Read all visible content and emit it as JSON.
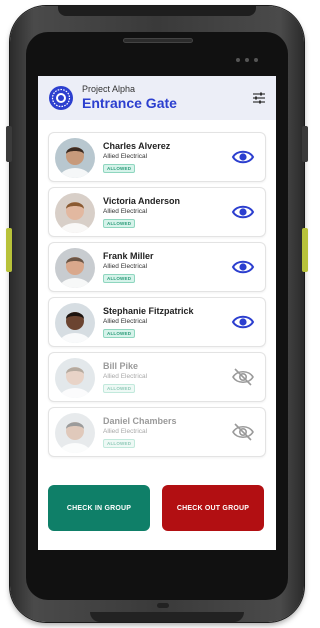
{
  "header": {
    "project": "Project Alpha",
    "gate": "Entrance Gate",
    "filter_icon": "filter-sliders-icon"
  },
  "people": [
    {
      "name": "Charles Alverez",
      "company": "Allied Electrical",
      "status": "ALLOWED",
      "visible": true,
      "skin": "#c79a7b",
      "hair": "#3b2a20",
      "bg": "#b8c7cf"
    },
    {
      "name": "Victoria Anderson",
      "company": "Allied Electrical",
      "status": "ALLOWED",
      "visible": true,
      "skin": "#e2b8a0",
      "hair": "#8a5a32",
      "bg": "#d8cfc8"
    },
    {
      "name": "Frank Miller",
      "company": "Allied Electrical",
      "status": "ALLOWED",
      "visible": true,
      "skin": "#d9a88c",
      "hair": "#6b5545",
      "bg": "#c8ccd0"
    },
    {
      "name": "Stephanie Fitzpatrick",
      "company": "Allied Electrical",
      "status": "ALLOWED",
      "visible": true,
      "skin": "#6b4430",
      "hair": "#1c1410",
      "bg": "#d6dde2"
    },
    {
      "name": "Bill Pike",
      "company": "Allied Electrical",
      "status": "ALLOWED",
      "visible": false,
      "skin": "#d6b09a",
      "hair": "#7a6652",
      "bg": "#cdd6dc"
    },
    {
      "name": "Daniel Chambers",
      "company": "Allied Electrical",
      "status": "ALLOWED",
      "visible": false,
      "skin": "#c89e84",
      "hair": "#4a4a4a",
      "bg": "#d4dade"
    }
  ],
  "actions": {
    "check_in": "CHECK IN GROUP",
    "check_out": "CHECK OUT GROUP"
  },
  "colors": {
    "accent": "#2c3fcf",
    "check_in": "#0f7f68",
    "check_out": "#b20f12",
    "badge": "#2a9a78"
  }
}
